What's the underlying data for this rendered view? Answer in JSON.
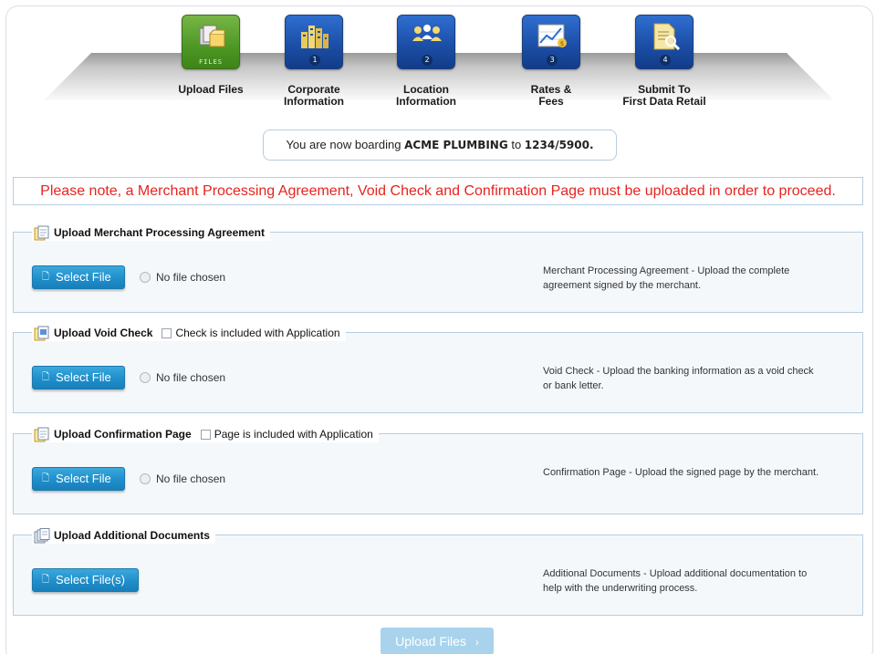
{
  "wizard": {
    "steps": [
      {
        "label": "Upload Files",
        "icon": "upload-files-icon",
        "badge": "FILES",
        "active": true
      },
      {
        "label": "Corporate\nInformation",
        "icon": "buildings-icon",
        "badge": "1"
      },
      {
        "label": "Location\nInformation",
        "icon": "people-icon",
        "badge": "2"
      },
      {
        "label": "Rates &\nFees",
        "icon": "rates-chart-icon",
        "badge": "3"
      },
      {
        "label": "Submit To\nFirst Data Retail",
        "icon": "document-search-icon",
        "badge": "4"
      }
    ]
  },
  "boarding": {
    "prefix": "You are now boarding",
    "merchant": "ACME PLUMBING",
    "middle": "to",
    "account": "1234/5900."
  },
  "notice": "Please note, a Merchant Processing Agreement, Void Check and Confirmation Page must be uploaded in order to proceed.",
  "sections": [
    {
      "title": "Upload Merchant Processing Agreement",
      "button": "Select File",
      "status": "No file chosen",
      "description": "Merchant Processing Agreement - Upload the complete agreement signed by the merchant."
    },
    {
      "title": "Upload Void Check",
      "checkbox": "Check is included with Application",
      "button": "Select File",
      "status": "No file chosen",
      "description": "Void Check - Upload the banking information as a void check or bank letter."
    },
    {
      "title": "Upload Confirmation Page",
      "checkbox": "Page is included with Application",
      "button": "Select File",
      "status": "No file chosen",
      "description": "Confirmation Page - Upload the signed page by the merchant."
    },
    {
      "title": "Upload Additional Documents",
      "button": "Select File(s)",
      "description": "Additional Documents - Upload additional documentation to help with the underwriting process."
    }
  ],
  "submit": {
    "label": "Upload Files",
    "arrow": "›"
  },
  "colors": {
    "notice": "#e8231e",
    "button": "#1f8fcb",
    "step_active": "#4f9a27",
    "step": "#1c4fa8"
  }
}
